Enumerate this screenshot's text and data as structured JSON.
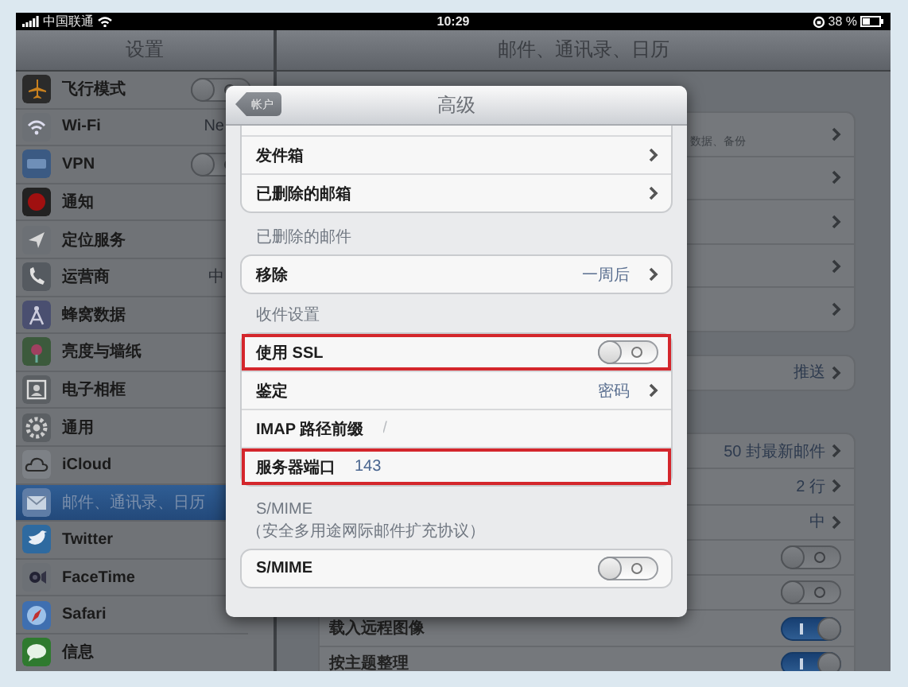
{
  "status_bar": {
    "carrier": "中国联通",
    "time": "10:29",
    "battery": "38 %"
  },
  "sidebar": {
    "title": "设置",
    "items": [
      {
        "label": "飞行模式",
        "kind": "toggle",
        "on": false,
        "selected": false
      },
      {
        "label": "Wi-Fi",
        "kind": "link",
        "value": "Ne",
        "selected": false
      },
      {
        "label": "VPN",
        "kind": "toggle",
        "on": false,
        "selected": false
      },
      {
        "label": "通知",
        "kind": "link",
        "selected": false
      },
      {
        "label": "定位服务",
        "kind": "link",
        "selected": false
      },
      {
        "label": "运营商",
        "kind": "link",
        "value": "中",
        "selected": false
      },
      {
        "label": "蜂窝数据",
        "kind": "link",
        "selected": false
      },
      {
        "label": "亮度与墙纸",
        "kind": "link",
        "selected": false
      },
      {
        "label": "电子相框",
        "kind": "link",
        "selected": false
      },
      {
        "label": "通用",
        "kind": "link",
        "selected": false
      },
      {
        "label": "iCloud",
        "kind": "link",
        "selected": false
      },
      {
        "label": "邮件、通讯录、日历",
        "kind": "link",
        "selected": true
      },
      {
        "label": "Twitter",
        "kind": "link",
        "selected": false
      },
      {
        "label": "FaceTime",
        "kind": "link",
        "selected": false
      },
      {
        "label": "Safari",
        "kind": "link",
        "selected": false
      },
      {
        "label": "信息",
        "kind": "link",
        "selected": false
      }
    ]
  },
  "detail": {
    "title": "邮件、通讯录、日历",
    "groups": [
      {
        "rows": [
          {
            "kind": "link",
            "note": "数据、备份"
          },
          {
            "kind": "link"
          },
          {
            "kind": "link"
          },
          {
            "kind": "link"
          },
          {
            "kind": "link"
          }
        ]
      },
      {
        "rows": [
          {
            "kind": "link",
            "value": "推送"
          }
        ]
      },
      {
        "rows": [
          {
            "kind": "link",
            "value": "50 封最新邮件"
          },
          {
            "kind": "link",
            "value": "2 行"
          },
          {
            "kind": "link",
            "value": "中"
          },
          {
            "kind": "toggle",
            "on": false
          },
          {
            "kind": "toggle",
            "on": false
          },
          {
            "kind": "toggle",
            "label": "载入远程图像",
            "on": true
          },
          {
            "kind": "toggle",
            "label": "按主题整理",
            "on": true
          }
        ]
      }
    ]
  },
  "popover": {
    "back": "帐户",
    "title": "高级",
    "sections": [
      {
        "rows": [
          {
            "kind": "link",
            "label": "发件箱",
            "highlighted": false
          },
          {
            "kind": "link",
            "label": "已删除的邮箱",
            "highlighted": false
          }
        ]
      },
      {
        "header": "已删除的邮件",
        "rows": [
          {
            "kind": "link",
            "label": "移除",
            "value": "一周后",
            "highlighted": false
          }
        ]
      },
      {
        "header": "收件设置",
        "rows": [
          {
            "kind": "toggle",
            "label": "使用 SSL",
            "on": false,
            "highlighted": true
          },
          {
            "kind": "link",
            "label": "鉴定",
            "value": "密码",
            "highlighted": false
          },
          {
            "kind": "field",
            "label": "IMAP 路径前缀",
            "placeholder": "/",
            "highlighted": false
          },
          {
            "kind": "field",
            "label": "服务器端口",
            "value": "143",
            "highlighted": true
          }
        ]
      },
      {
        "header": "S/MIME",
        "note": "（安全多用途网际邮件扩充协议）",
        "rows": [
          {
            "kind": "toggle",
            "label": "S/MIME",
            "on": false,
            "highlighted": false
          }
        ]
      }
    ]
  }
}
